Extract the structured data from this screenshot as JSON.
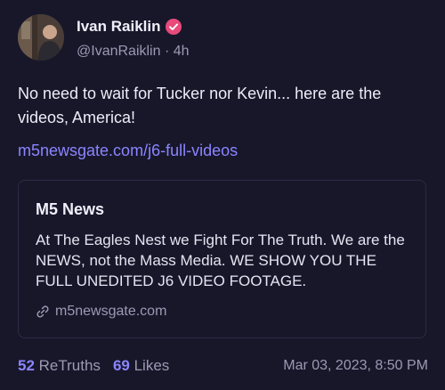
{
  "author": {
    "display_name": "Ivan Raiklin",
    "handle": "@IvanRaiklin",
    "separator": "·",
    "time_ago": "4h",
    "verified": true
  },
  "post": {
    "text": "No need to wait for Tucker nor Kevin...  here are the videos, America!",
    "link": "m5newsgate.com/j6-full-videos"
  },
  "card": {
    "title": "M5 News",
    "description": "At The Eagles Nest we Fight For The Truth. We are the NEWS, not the Mass Media. WE SHOW YOU THE FULL UNEDITED J6 VIDEO FOOTAGE.",
    "domain": "m5newsgate.com",
    "icon": "link-icon"
  },
  "stats": {
    "retruths_count": "52",
    "retruths_label": "ReTruths",
    "likes_count": "69",
    "likes_label": "Likes",
    "timestamp": "Mar 03, 2023, 8:50 PM"
  },
  "colors": {
    "background": "#18172a",
    "accent": "#8b85ff",
    "muted": "#9c99b3",
    "verified_badge": "#e84a7a"
  }
}
